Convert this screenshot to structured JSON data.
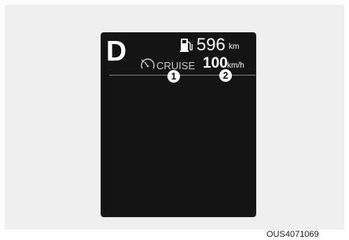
{
  "display": {
    "gear": "D",
    "fuel_icon": "fuel-pump-icon",
    "range_value": "596",
    "range_unit": "km",
    "cruise_icon": "cruise-speedometer-icon",
    "cruise_label": "CRUISE",
    "set_speed": "100",
    "speed_unit": "km/h",
    "callouts": [
      "1",
      "2"
    ],
    "background_color": "#141414",
    "text_color": "#ffffff"
  },
  "figure": {
    "reference_code": "OUS4071069"
  }
}
